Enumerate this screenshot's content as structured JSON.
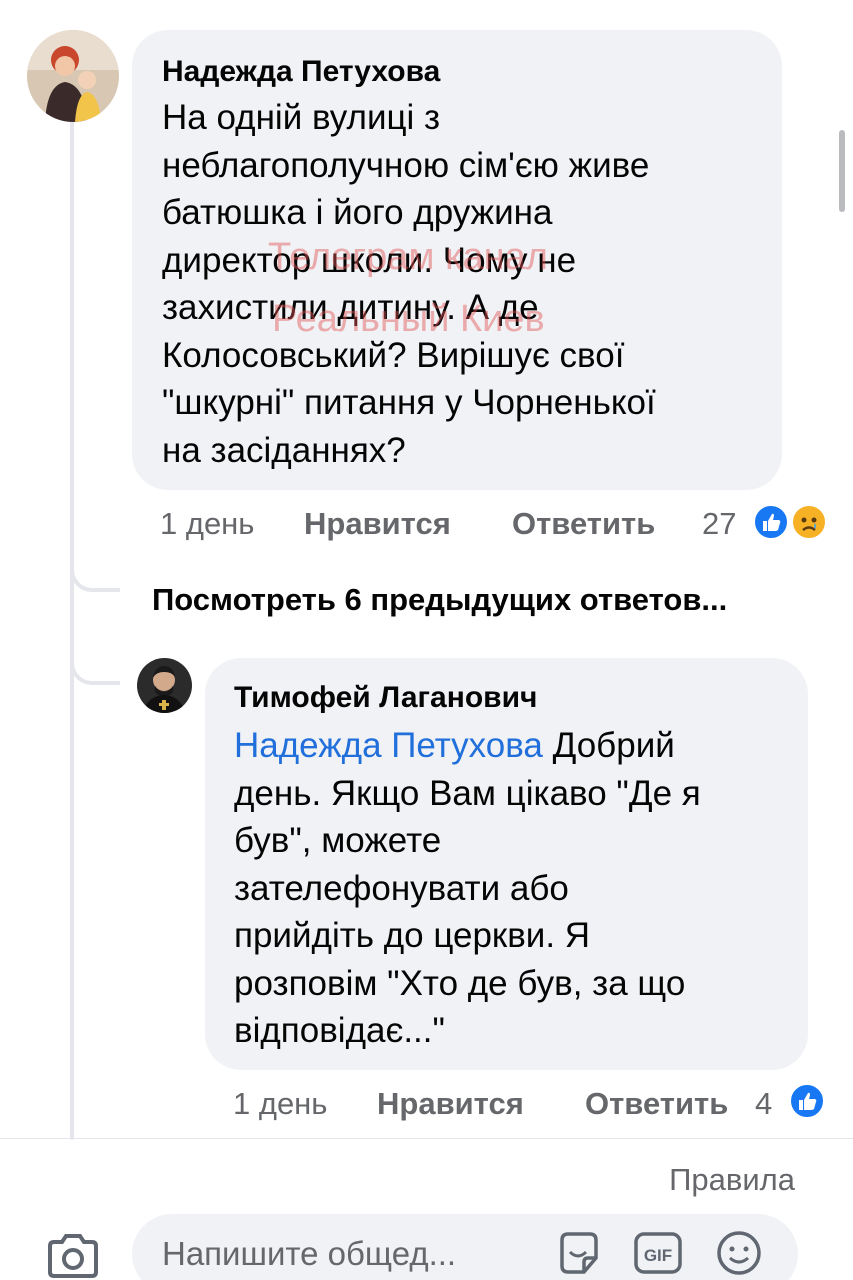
{
  "comment1": {
    "author": "Надежда Петухова",
    "lines": [
      "На одній вулиці з",
      "неблагополучною сім'єю живе",
      "батюшка і його дружина",
      "директор школи. Чому не",
      "захистили дитину. А де",
      "Колосовський? Вирішує свої",
      "\"шкурні\" питання у Чорненької",
      "на засіданнях?"
    ],
    "time": "1 день",
    "like_label": "Нравится",
    "reply_label": "Ответить",
    "reaction_count": "27",
    "reactions": [
      "like-icon",
      "sad-face-icon"
    ]
  },
  "view_more": "Посмотреть 6 предыдущих ответов...",
  "comment2": {
    "author": "Тимофей Лаганович",
    "mention": "Надежда Петухова",
    "first_line_rest": " Добрий",
    "lines": [
      "день. Якщо Вам цікаво \"Де я",
      "був\", можете",
      "зателефонувати або",
      "прийдіть до церкви. Я",
      "розповім \"Хто де був, за що",
      "відповідає...\""
    ],
    "time": "1 день",
    "like_label": "Нравится",
    "reply_label": "Ответить",
    "reaction_count": "4",
    "reactions": [
      "like-icon"
    ]
  },
  "watermark": {
    "line1": "Телеграм канал",
    "line2": "Реальный Киев"
  },
  "footer": {
    "rules_label": "Правила",
    "composer_placeholder": "Напишите общед...",
    "icons": [
      "camera-icon",
      "sticker-icon",
      "gif-icon",
      "emoji-icon"
    ]
  },
  "colors": {
    "mention": "#216fdb",
    "bubble": "#f0f2f5",
    "meta": "#65676b",
    "like": "#1877f2",
    "watermark": "#e25050"
  }
}
